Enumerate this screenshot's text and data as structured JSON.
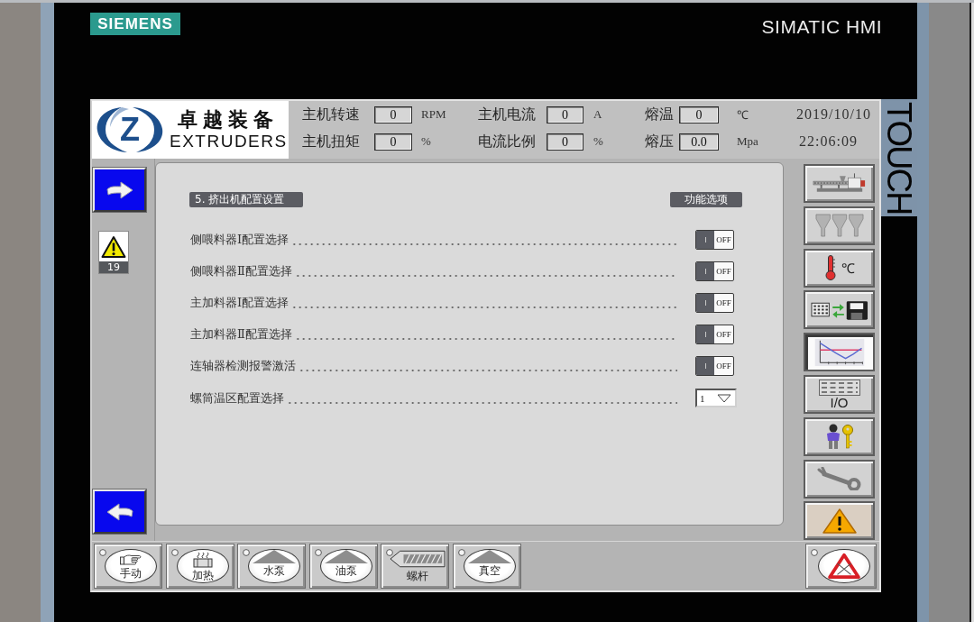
{
  "device": {
    "brand": "SIEMENS",
    "model": "SIMATIC HMI",
    "side_label": "TOUCH"
  },
  "header": {
    "logo": {
      "letter": "Z",
      "title": "卓越装备",
      "subtitle": "EXTRUDERS"
    },
    "readings": [
      {
        "label": "主机转速",
        "value": "0",
        "unit": "RPM"
      },
      {
        "label": "主机电流",
        "value": "0",
        "unit": "A"
      },
      {
        "label": "熔温",
        "value": "0",
        "unit": "℃"
      },
      {
        "label": "主机扭矩",
        "value": "0",
        "unit": "%"
      },
      {
        "label": "电流比例",
        "value": "0",
        "unit": "%"
      },
      {
        "label": "熔压",
        "value": "0.0",
        "unit": "Mpa"
      }
    ],
    "date": "2019/10/10",
    "time": "22:06:09"
  },
  "alarm_indicator": {
    "count": "19"
  },
  "config": {
    "title": "5. 挤出机配置设置",
    "column_label": "功能选项",
    "rows": [
      {
        "kind": "toggle",
        "label": "侧喂料器Ⅰ配置选择",
        "on": false,
        "state_label": "OFF"
      },
      {
        "kind": "toggle",
        "label": "侧喂料器Ⅱ配置选择",
        "on": false,
        "state_label": "OFF"
      },
      {
        "kind": "toggle",
        "label": "主加料器Ⅰ配置选择",
        "on": false,
        "state_label": "OFF"
      },
      {
        "kind": "toggle",
        "label": "主加料器Ⅱ配置选择",
        "on": false,
        "state_label": "OFF"
      },
      {
        "kind": "toggle",
        "label": "连轴器检测报警激活",
        "on": false,
        "state_label": "OFF"
      },
      {
        "kind": "dropdown",
        "label": "螺筒温区配置选择",
        "value": "1"
      }
    ]
  },
  "side_nav": [
    {
      "kind": "extruder",
      "selected": false
    },
    {
      "kind": "hoppers",
      "selected": false
    },
    {
      "kind": "temperature",
      "label": "℃",
      "selected": false
    },
    {
      "kind": "transfer",
      "selected": false
    },
    {
      "kind": "trend",
      "selected": true
    },
    {
      "kind": "io",
      "label": "I/O",
      "selected": false
    },
    {
      "kind": "user",
      "selected": false
    },
    {
      "kind": "tools",
      "selected": false
    },
    {
      "kind": "alarm",
      "selected": false
    }
  ],
  "bottom_bar": {
    "keys": [
      {
        "kind": "hand",
        "label": "手动",
        "lamp_on": false
      },
      {
        "kind": "heater",
        "label": "加热",
        "lamp_on": false
      },
      {
        "kind": "pump",
        "label": "水泵",
        "lamp_on": false
      },
      {
        "kind": "pump",
        "label": "油泵",
        "lamp_on": false
      },
      {
        "kind": "screw",
        "label": "螺杆",
        "lamp_on": false
      },
      {
        "kind": "pump",
        "label": "真空",
        "lamp_on": false
      }
    ],
    "reset": {
      "lamp_on": false
    }
  }
}
